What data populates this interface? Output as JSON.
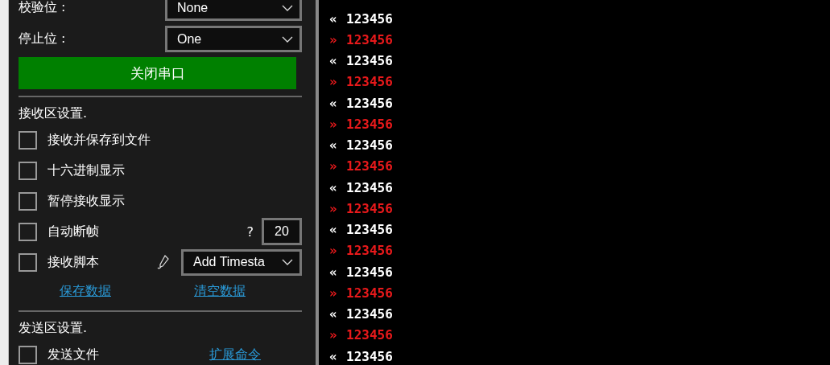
{
  "settings": [
    {
      "label": "校验位 :",
      "value": "None"
    },
    {
      "label": "停止位 :",
      "value": "One"
    }
  ],
  "port_button": "关闭串口",
  "receive": {
    "heading": "接收区设置.",
    "options": [
      {
        "kind": "checkbox",
        "label": "接收并保存到文件",
        "checked": false
      },
      {
        "kind": "checkbox",
        "label": "十六进制显示",
        "checked": false
      },
      {
        "kind": "checkbox",
        "label": "暂停接收显示",
        "checked": false
      },
      {
        "kind": "number",
        "label": "自动断帧",
        "checked": false,
        "hint": "?",
        "value": "20"
      },
      {
        "kind": "script",
        "label": "接收脚本",
        "checked": false,
        "value": "Add Timesta"
      }
    ],
    "links": [
      "保存数据",
      "清空数据"
    ]
  },
  "send": {
    "heading": "发送区设置.",
    "option": {
      "label": "发送文件",
      "checked": false
    },
    "link": "扩展命令"
  },
  "log": [
    {
      "kind": "rx",
      "marker": "«",
      "text": "123456"
    },
    {
      "kind": "tx",
      "marker": "»",
      "text": "123456"
    },
    {
      "kind": "rx",
      "marker": "«",
      "text": "123456"
    },
    {
      "kind": "tx",
      "marker": "»",
      "text": "123456"
    },
    {
      "kind": "rx",
      "marker": "«",
      "text": "123456"
    },
    {
      "kind": "tx",
      "marker": "»",
      "text": "123456"
    },
    {
      "kind": "rx",
      "marker": "«",
      "text": "123456"
    },
    {
      "kind": "tx",
      "marker": "»",
      "text": "123456"
    },
    {
      "kind": "rx",
      "marker": "«",
      "text": "123456"
    },
    {
      "kind": "tx",
      "marker": "»",
      "text": "123456"
    },
    {
      "kind": "rx",
      "marker": "«",
      "text": "123456"
    },
    {
      "kind": "tx",
      "marker": "»",
      "text": "123456"
    },
    {
      "kind": "rx",
      "marker": "«",
      "text": "123456"
    },
    {
      "kind": "tx",
      "marker": "»",
      "text": "123456"
    },
    {
      "kind": "rx",
      "marker": "«",
      "text": "123456"
    },
    {
      "kind": "tx",
      "marker": "»",
      "text": "123456"
    },
    {
      "kind": "rx",
      "marker": "«",
      "text": "123456"
    }
  ]
}
